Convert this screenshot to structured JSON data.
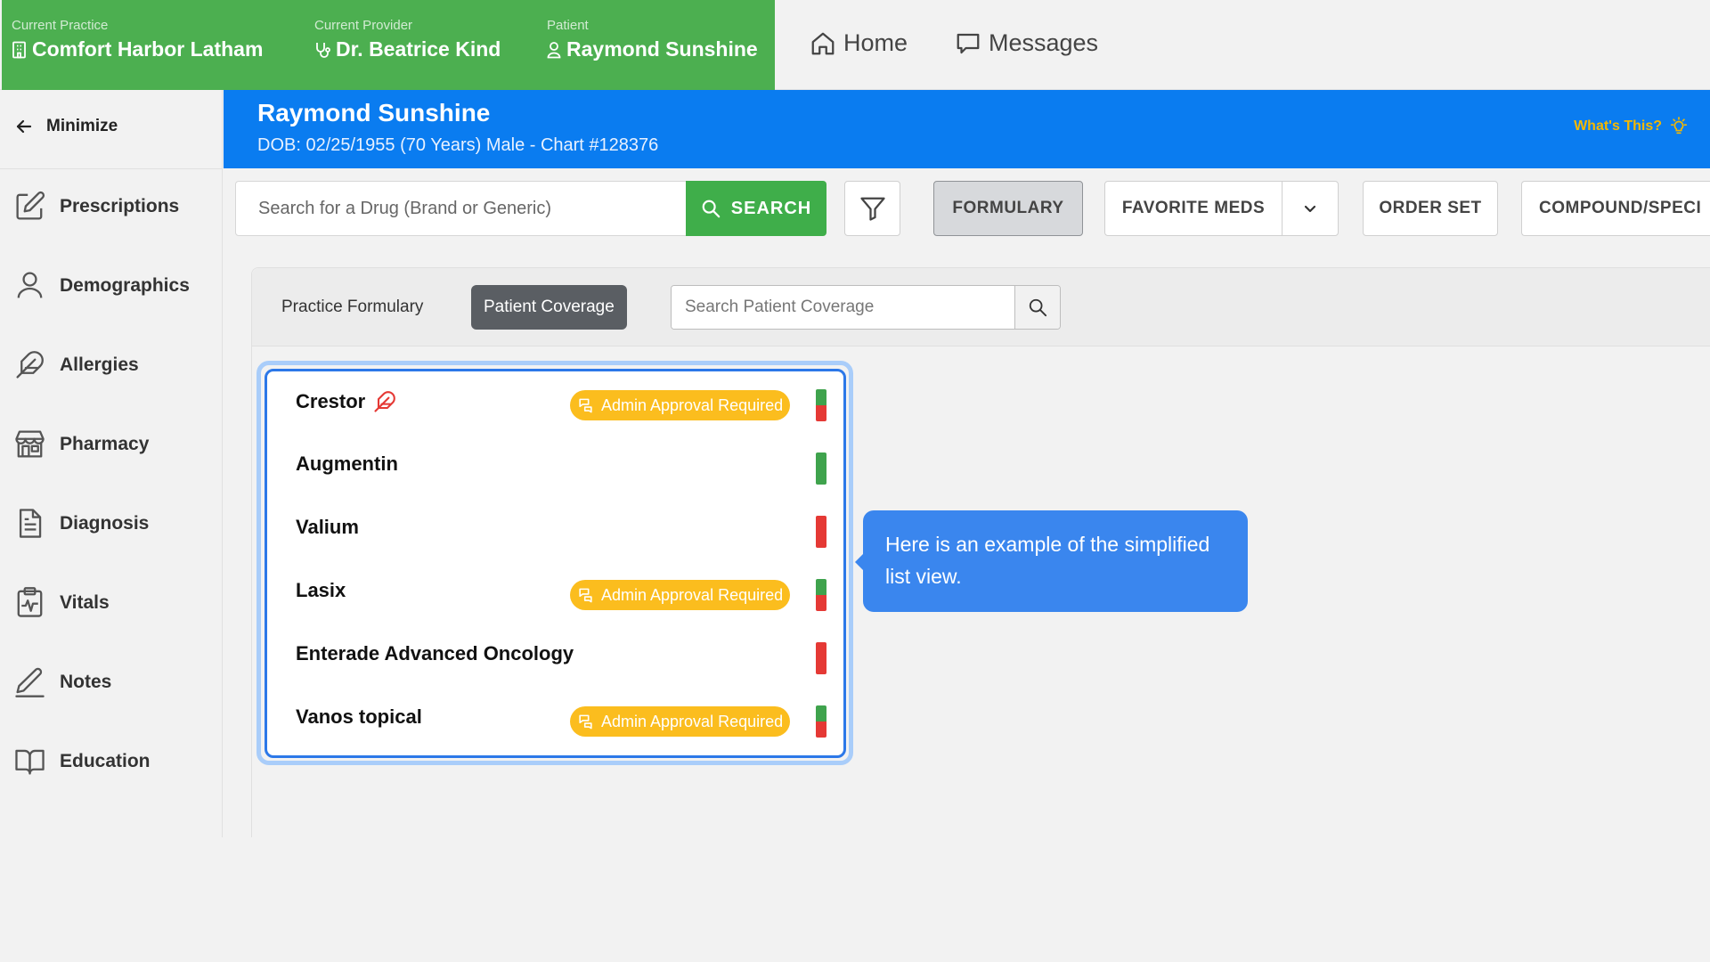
{
  "context": {
    "practice_label": "Current Practice",
    "practice": "Comfort Harbor Latham",
    "provider_label": "Current Provider",
    "provider": "Dr. Beatrice Kind",
    "patient_label": "Patient",
    "patient": "Raymond Sunshine"
  },
  "topnav": {
    "home": "Home",
    "messages": "Messages"
  },
  "sidebar": {
    "minimize": "Minimize",
    "items": [
      {
        "label": "Prescriptions",
        "icon": "prescription-pen-icon"
      },
      {
        "label": "Demographics",
        "icon": "person-icon"
      },
      {
        "label": "Allergies",
        "icon": "feather-icon"
      },
      {
        "label": "Pharmacy",
        "icon": "storefront-icon"
      },
      {
        "label": "Diagnosis",
        "icon": "document-icon"
      },
      {
        "label": "Vitals",
        "icon": "clipboard-pulse-icon"
      },
      {
        "label": "Notes",
        "icon": "pencil-icon"
      },
      {
        "label": "Education",
        "icon": "book-icon"
      }
    ]
  },
  "banner": {
    "name": "Raymond Sunshine",
    "info": "DOB: 02/25/1955 (70 Years) Male - Chart #128376",
    "whats_this": "What's This?"
  },
  "search": {
    "placeholder": "Search for a Drug (Brand or Generic)",
    "button": "SEARCH"
  },
  "toolbar": {
    "formulary": "FORMULARY",
    "favorite_meds": "FAVORITE MEDS",
    "order_set": "ORDER SET",
    "compound": "COMPOUND/SPECI"
  },
  "formulary": {
    "tab_practice": "Practice Formulary",
    "tab_patient": "Patient Coverage",
    "search_placeholder": "Search Patient Coverage",
    "badge_label": "Admin Approval Required",
    "colors": {
      "covered": "#3fa34d",
      "not_covered": "#e53935",
      "badge": "#fbbd1e"
    },
    "items": [
      {
        "name": "Crestor",
        "allergy": true,
        "admin": true,
        "status": [
          "covered",
          "not_covered"
        ]
      },
      {
        "name": "Augmentin",
        "allergy": false,
        "admin": false,
        "status": [
          "covered",
          "covered"
        ]
      },
      {
        "name": "Valium",
        "allergy": false,
        "admin": false,
        "status": [
          "not_covered",
          "not_covered"
        ]
      },
      {
        "name": "Lasix",
        "allergy": false,
        "admin": true,
        "status": [
          "covered",
          "not_covered"
        ]
      },
      {
        "name": "Enterade Advanced Oncology",
        "allergy": false,
        "admin": false,
        "status": [
          "not_covered",
          "not_covered"
        ]
      },
      {
        "name": "Vanos topical",
        "allergy": false,
        "admin": true,
        "status": [
          "covered",
          "not_covered"
        ]
      }
    ]
  },
  "tooltip": {
    "text": "Here is an example of the simplified list view."
  }
}
